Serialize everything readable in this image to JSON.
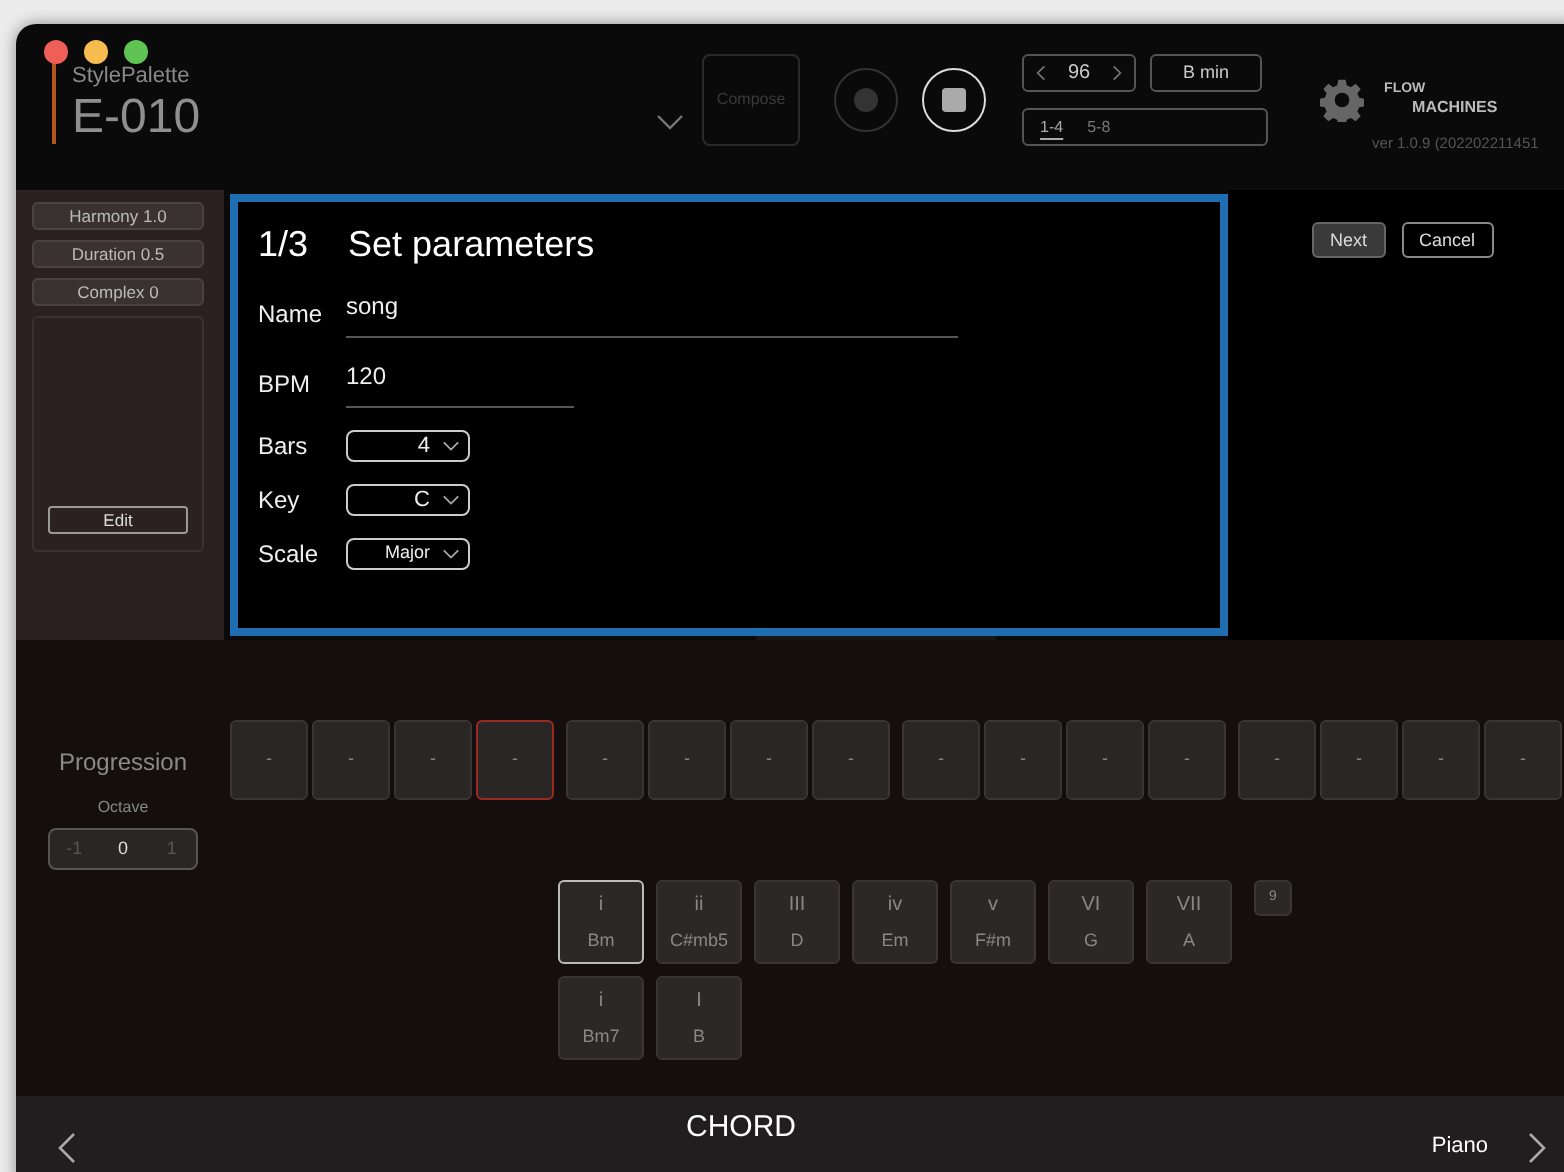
{
  "header": {
    "app_name": "StylePalette",
    "style_name": "E-010",
    "compose_button": "Compose",
    "tempo": "96",
    "key": "B min",
    "bar_tabs": [
      {
        "label": "1-4",
        "selected": true
      },
      {
        "label": "5-8",
        "selected": false
      }
    ],
    "logo_top": "FLOW",
    "logo_bottom": "MACHINES",
    "version": "ver 1.0.9 (202202211451"
  },
  "sidebar": {
    "params": [
      "Harmony 1.0",
      "Duration 0.5",
      "Complex 0"
    ],
    "edit_button": "Edit"
  },
  "dialog": {
    "step": "1/3",
    "title": "Set parameters",
    "fields": [
      {
        "kind": "text",
        "label": "Name",
        "value": "song",
        "wide": true
      },
      {
        "kind": "text",
        "label": "BPM",
        "value": "120",
        "wide": false
      },
      {
        "kind": "select",
        "label": "Bars",
        "value": "4"
      },
      {
        "kind": "select",
        "label": "Key",
        "value": "C"
      },
      {
        "kind": "select",
        "label": "Scale",
        "value": "Major"
      }
    ]
  },
  "actions": [
    {
      "label": "Next",
      "kind": "primary"
    },
    {
      "label": "Cancel",
      "kind": "secondary"
    }
  ],
  "progression": {
    "label": "Progression",
    "octave_label": "Octave",
    "octave": [
      {
        "label": "-1",
        "selected": false
      },
      {
        "label": "0",
        "selected": true
      },
      {
        "label": "1",
        "selected": false
      }
    ],
    "cells": [
      {
        "label": "-",
        "selected": false
      },
      {
        "label": "-",
        "selected": false
      },
      {
        "label": "-",
        "selected": false
      },
      {
        "label": "-",
        "selected": true
      },
      {
        "label": "-",
        "selected": false
      },
      {
        "label": "-",
        "selected": false
      },
      {
        "label": "-",
        "selected": false
      },
      {
        "label": "-",
        "selected": false
      },
      {
        "label": "-",
        "selected": false
      },
      {
        "label": "-",
        "selected": false
      },
      {
        "label": "-",
        "selected": false
      },
      {
        "label": "-",
        "selected": false
      },
      {
        "label": "-",
        "selected": false
      },
      {
        "label": "-",
        "selected": false
      },
      {
        "label": "-",
        "selected": false
      },
      {
        "label": "-",
        "selected": false
      }
    ]
  },
  "chords": {
    "rows": [
      [
        {
          "degree": "i",
          "name": "Bm",
          "selected": true
        },
        {
          "degree": "ii",
          "name": "C#mb5",
          "selected": false
        },
        {
          "degree": "III",
          "name": "D",
          "selected": false
        },
        {
          "degree": "iv",
          "name": "Em",
          "selected": false
        },
        {
          "degree": "v",
          "name": "F#m",
          "selected": false
        },
        {
          "degree": "VI",
          "name": "G",
          "selected": false
        },
        {
          "degree": "VII",
          "name": "A",
          "selected": false
        }
      ],
      [
        {
          "degree": "i",
          "name": "Bm7",
          "selected": false
        },
        {
          "degree": "I",
          "name": "B",
          "selected": false
        }
      ]
    ],
    "extra_button": "9"
  },
  "bottom_bar": {
    "title": "CHORD",
    "instrument": "Piano"
  }
}
